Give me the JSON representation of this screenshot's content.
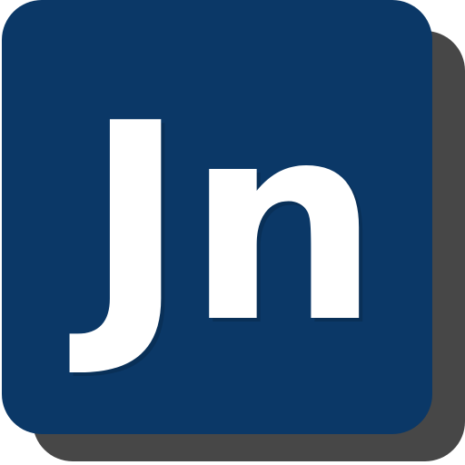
{
  "icon": {
    "name": "app-icon",
    "monogram": "Jn",
    "colors": {
      "tile": "#0b3867",
      "shadow": "#474747",
      "text": "#ffffff",
      "text_shadow": "#082a4d"
    }
  }
}
